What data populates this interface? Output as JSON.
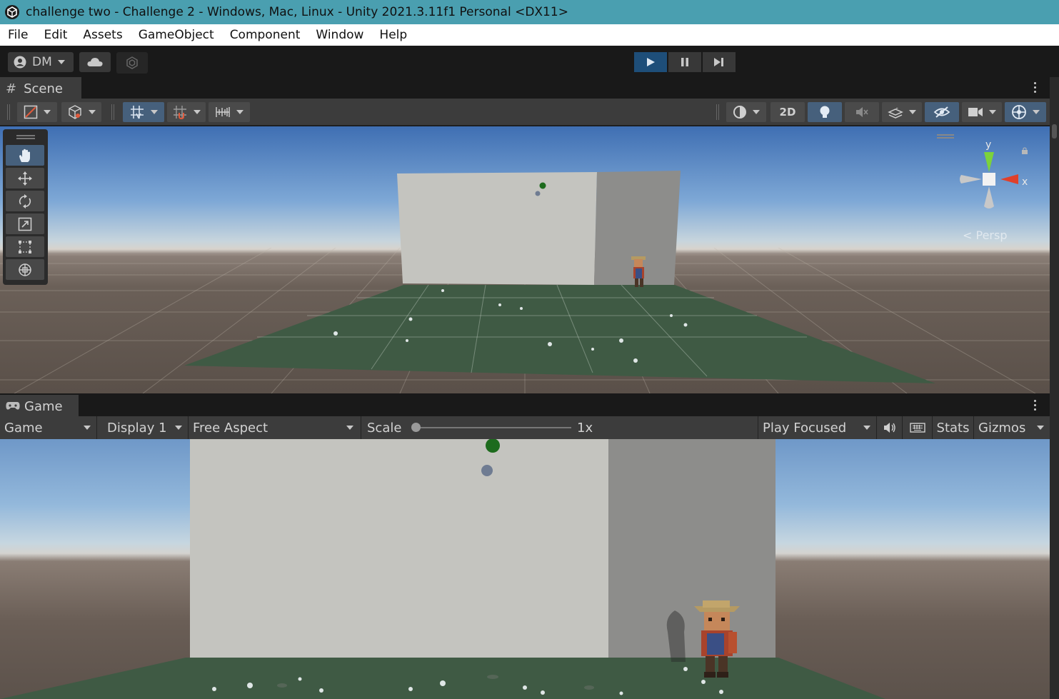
{
  "window": {
    "title": "challenge two - Challenge 2 - Windows, Mac, Linux - Unity 2021.3.11f1 Personal <DX11>"
  },
  "menu": [
    "File",
    "Edit",
    "Assets",
    "GameObject",
    "Component",
    "Window",
    "Help"
  ],
  "toolbar": {
    "account_label": "DM",
    "play_state": "playing"
  },
  "scene": {
    "tab_label": "Scene",
    "toggle_2d": "2D",
    "projection": "Persp",
    "gizmo_axes": {
      "y": "y",
      "x": "x"
    },
    "active_tool": "hand-tool"
  },
  "game": {
    "tab_label": "Game",
    "view_select": "Game",
    "display_select": "Display 1",
    "aspect_select": "Free Aspect",
    "scale_label": "Scale",
    "scale_value": "1x",
    "play_mode_select": "Play Focused",
    "stats_label": "Stats",
    "gizmos_label": "Gizmos"
  },
  "colors": {
    "titlebar": "#4a9fb0",
    "active_blue": "#46607c",
    "play_active": "#1e4e79",
    "panel": "#3c3c3c",
    "gizmo_x": "#e0402a",
    "gizmo_y": "#7cd23a"
  }
}
